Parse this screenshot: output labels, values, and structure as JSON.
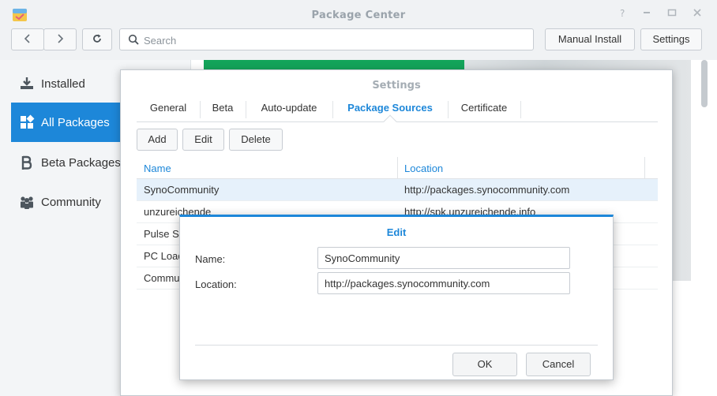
{
  "window": {
    "title": "Package Center",
    "controls": [
      "help-icon",
      "pin-icon",
      "maximize-icon",
      "close-icon"
    ]
  },
  "toolbar": {
    "back_icon": "chevron-left-icon",
    "forward_icon": "chevron-right-icon",
    "refresh_icon": "refresh-icon",
    "search_placeholder": "Search",
    "manual_install_label": "Manual Install",
    "settings_label": "Settings"
  },
  "sidebar": {
    "items": [
      {
        "label": "Installed",
        "icon": "download-tray-icon",
        "active": false
      },
      {
        "label": "All Packages",
        "icon": "grid-icon",
        "active": true
      },
      {
        "label": "Beta Packages",
        "icon": "beta-icon",
        "active": false
      },
      {
        "label": "Community",
        "icon": "people-icon",
        "active": false
      }
    ]
  },
  "settings_dialog": {
    "title": "Settings",
    "tabs": [
      {
        "label": "General",
        "active": false
      },
      {
        "label": "Beta",
        "active": false
      },
      {
        "label": "Auto-update",
        "active": false
      },
      {
        "label": "Package Sources",
        "active": true
      },
      {
        "label": "Certificate",
        "active": false
      }
    ],
    "buttons": {
      "add": "Add",
      "edit": "Edit",
      "delete": "Delete"
    },
    "grid": {
      "columns": [
        "Name",
        "Location"
      ],
      "rows": [
        {
          "name": "SynoCommunity",
          "location": "http://packages.synocommunity.com",
          "selected": true
        },
        {
          "name": "unzureichende",
          "location": "http://spk.unzureichende.info",
          "selected": false
        },
        {
          "name": "Pulse St",
          "location": "",
          "selected": false
        },
        {
          "name": "PC Load",
          "location": "",
          "selected": false
        },
        {
          "name": "Commu",
          "location": "",
          "selected": false
        }
      ]
    }
  },
  "edit_dialog": {
    "title": "Edit",
    "name_label": "Name:",
    "name_value": "SynoCommunity",
    "location_label": "Location:",
    "location_value": "http://packages.synocommunity.com",
    "ok_label": "OK",
    "cancel_label": "Cancel"
  },
  "colors": {
    "accent": "#1d87d9",
    "selected_row": "#e6f1fb",
    "banner_green": "#13a45a"
  }
}
